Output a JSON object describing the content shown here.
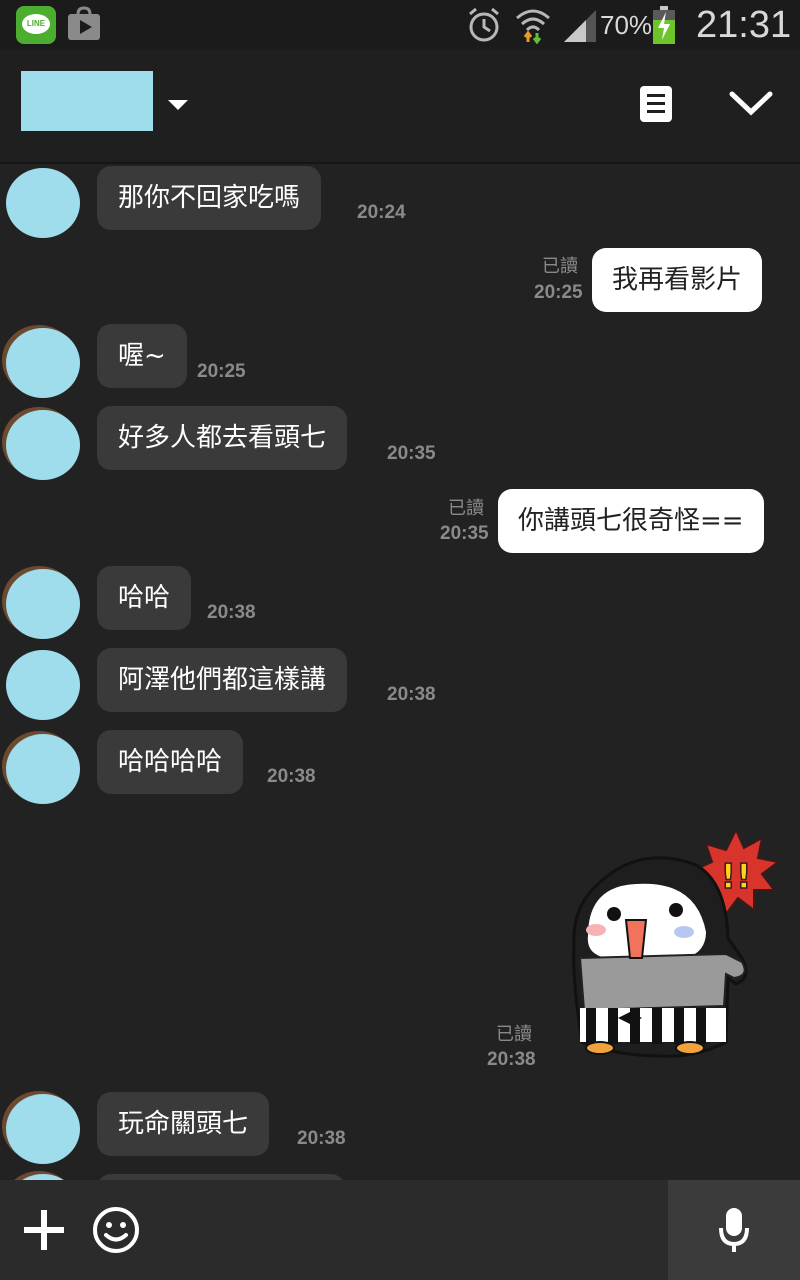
{
  "status_bar": {
    "line_icon_label": "LINE",
    "battery_percent": "70%",
    "time": "21:31",
    "icons": [
      "line-app-icon",
      "play-store-icon",
      "alarm-icon",
      "wifi-icon",
      "signal-icon",
      "battery-charging-icon"
    ]
  },
  "header": {
    "chat_name": "",
    "icons": [
      "dropdown-caret-icon",
      "note-icon",
      "chevron-down-icon"
    ]
  },
  "messages": [
    {
      "side": "in",
      "text": "那你不回家吃嗎",
      "time": "20:24"
    },
    {
      "side": "out",
      "text": "我再看影片",
      "read": "已讀",
      "time": "20:25"
    },
    {
      "side": "in",
      "text": "喔~",
      "time": "20:25"
    },
    {
      "side": "in",
      "text": "好多人都去看頭七",
      "time": "20:35"
    },
    {
      "side": "out",
      "text": "你講頭七很奇怪==",
      "read": "已讀",
      "time": "20:35"
    },
    {
      "side": "in",
      "text": "哈哈",
      "time": "20:38"
    },
    {
      "side": "in",
      "text": "阿澤他們都這樣講",
      "time": "20:38"
    },
    {
      "side": "in",
      "text": "哈哈哈哈",
      "time": "20:38"
    },
    {
      "side": "out",
      "type": "sticker",
      "sticker": "penguin-surprised-sticker",
      "sticker_text": "!!",
      "read": "已讀",
      "time": "20:38"
    },
    {
      "side": "in",
      "text": "玩命關頭七",
      "time": "20:38"
    }
  ],
  "input_bar": {
    "icons": [
      "plus-icon",
      "emoji-icon",
      "microphone-icon"
    ]
  },
  "colors": {
    "background": "#222222",
    "incoming_bubble": "#3a3a3a",
    "outgoing_bubble": "#ffffff",
    "avatar_mask": "#9fdcec",
    "line_green": "#4cae2f"
  }
}
